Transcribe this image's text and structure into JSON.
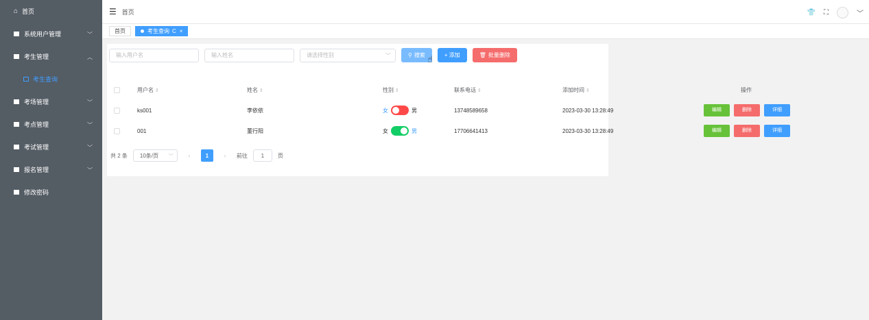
{
  "sidebar": {
    "home": "首页",
    "items": [
      {
        "label": "系统用户管理",
        "chevron": "﹀"
      },
      {
        "label": "考生管理",
        "chevron": "︿"
      },
      {
        "label": "考场管理",
        "chevron": "﹀"
      },
      {
        "label": "考点管理",
        "chevron": "﹀"
      },
      {
        "label": "考试管理",
        "chevron": "﹀"
      },
      {
        "label": "报名管理",
        "chevron": "﹀"
      },
      {
        "label": "修改密码",
        "chevron": ""
      }
    ],
    "active_sub": "考生查询"
  },
  "header": {
    "breadcrumb": "首页"
  },
  "tags": [
    {
      "label": "首页",
      "active": false
    },
    {
      "label": "考生查询",
      "active": true,
      "refresh": "C",
      "close": "×"
    }
  ],
  "filters": {
    "username_placeholder": "输入用户名",
    "name_placeholder": "输入姓名",
    "gender_placeholder": "请选择性别",
    "search_label": "搜索",
    "add_label": "+ 添加",
    "batch_delete_label": "批量删除"
  },
  "table": {
    "headers": [
      "用户名",
      "姓名",
      "性别",
      "联系电话",
      "添加时间",
      "操作"
    ],
    "rows": [
      {
        "username": "ks001",
        "name": "李依依",
        "gender_left": "女",
        "gender_right": "男",
        "gender_male": false,
        "phone": "13748589658",
        "added": "2023-03-30 13:28:49"
      },
      {
        "username": "001",
        "name": "董行阳",
        "gender_left": "女",
        "gender_right": "男",
        "gender_male": true,
        "phone": "17706641413",
        "added": "2023-03-30 13:28:49"
      }
    ],
    "actions": {
      "edit": "编辑",
      "delete": "删除",
      "detail": "详细"
    }
  },
  "pagination": {
    "total": "共 2 条",
    "page_size": "10条/页",
    "current_page": "1",
    "goto_label": "前往",
    "goto_value": "1",
    "page_suffix": "页"
  },
  "colors": {
    "switch_on": "#13ce66",
    "switch_off": "#ff4949",
    "accent": "#409eff"
  }
}
